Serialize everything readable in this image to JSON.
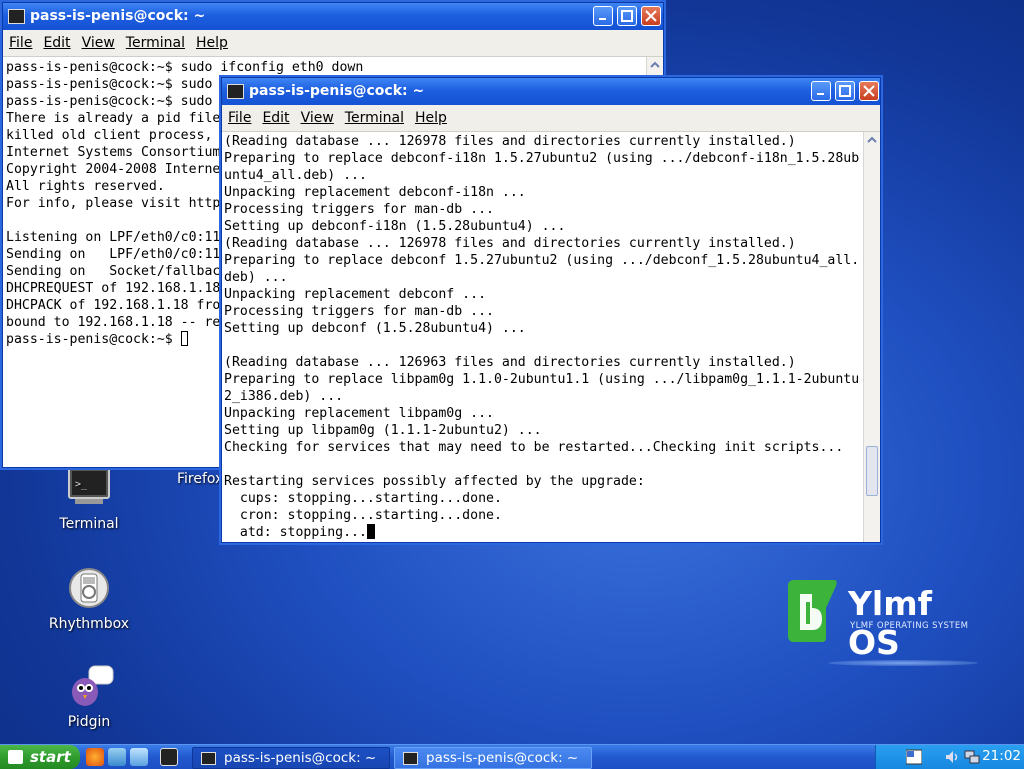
{
  "desktop": {
    "icons": [
      {
        "label": "Terminal"
      },
      {
        "label": "Rhythmbox"
      },
      {
        "label": "Pidgin"
      }
    ],
    "partial_icon_label": "Firefox",
    "logo": {
      "brand": "Ylmf OS",
      "subtitle": "YLMF OPERATING SYSTEM"
    }
  },
  "back_window": {
    "title": "pass-is-penis@cock: ~",
    "menu": [
      "File",
      "Edit",
      "View",
      "Terminal",
      "Help"
    ],
    "lines": [
      "pass-is-penis@cock:~$ sudo ifconfig eth0 down",
      "pass-is-penis@cock:~$ sudo",
      "pass-is-penis@cock:~$ sudo",
      "There is already a pid file",
      "killed old client process,",
      "Internet Systems Consortium",
      "Copyright 2004-2008 Interne",
      "All rights reserved.",
      "For info, please visit http",
      "",
      "Listening on LPF/eth0/c0:11",
      "Sending on   LPF/eth0/c0:11",
      "Sending on   Socket/fallbac",
      "DHCPREQUEST of 192.168.1.18",
      "DHCPACK of 192.168.1.18 fro",
      "bound to 192.168.1.18 -- re"
    ],
    "prompt": "pass-is-penis@cock:~$ "
  },
  "front_window": {
    "title": "pass-is-penis@cock: ~",
    "menu": [
      "File",
      "Edit",
      "View",
      "Terminal",
      "Help"
    ],
    "lines": [
      "(Reading database ... 126978 files and directories currently installed.)",
      "Preparing to replace debconf-i18n 1.5.27ubuntu2 (using .../debconf-i18n_1.5.28ub",
      "untu4_all.deb) ...",
      "Unpacking replacement debconf-i18n ...",
      "Processing triggers for man-db ...",
      "Setting up debconf-i18n (1.5.28ubuntu4) ...",
      "(Reading database ... 126978 files and directories currently installed.)",
      "Preparing to replace debconf 1.5.27ubuntu2 (using .../debconf_1.5.28ubuntu4_all.",
      "deb) ...",
      "Unpacking replacement debconf ...",
      "Processing triggers for man-db ...",
      "Setting up debconf (1.5.28ubuntu4) ...",
      "",
      "(Reading database ... 126963 files and directories currently installed.)",
      "Preparing to replace libpam0g 1.1.0-2ubuntu1.1 (using .../libpam0g_1.1.1-2ubuntu",
      "2_i386.deb) ...",
      "Unpacking replacement libpam0g ...",
      "Setting up libpam0g (1.1.1-2ubuntu2) ...",
      "Checking for services that may need to be restarted...Checking init scripts...",
      "",
      "Restarting services possibly affected by the upgrade:",
      "  cups: stopping...starting...done.",
      "  cron: stopping...starting...done."
    ],
    "last_line": "  atd: stopping...",
    "scroll_position": 0.92
  },
  "taskbar": {
    "start_label": "start",
    "tasks": [
      {
        "label": "pass-is-penis@cock: ~"
      },
      {
        "label": "pass-is-penis@cock: ~"
      }
    ],
    "clock": "21:02"
  },
  "colors": {
    "titlebar": "#1d5fe0",
    "start_button": "#2e9a2c",
    "logo_green": "#3cb43c"
  }
}
